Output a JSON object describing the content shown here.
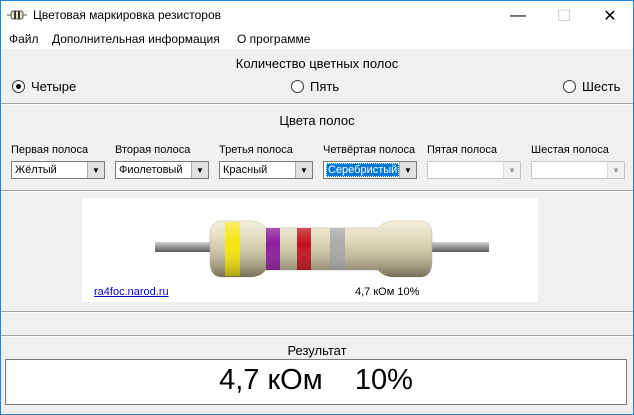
{
  "window": {
    "title": "Цветовая маркировка резисторов",
    "minimize_glyph": "—",
    "maximize_glyph": "☐",
    "close_glyph": "✕"
  },
  "menu": {
    "items": [
      "Файл",
      "Дополнительная информация",
      "О программе"
    ]
  },
  "band_count": {
    "title": "Количество цветных полос",
    "options": [
      "Четыре",
      "Пять",
      "Шесть"
    ],
    "selected": "Четыре"
  },
  "band_colors": {
    "title": "Цвета полос",
    "bands": [
      {
        "label": "Первая полоса",
        "value": "Жёлтый",
        "enabled": true,
        "focused": false
      },
      {
        "label": "Вторая полоса",
        "value": "Фиолетовый",
        "enabled": true,
        "focused": false
      },
      {
        "label": "Третья полоса",
        "value": "Красный",
        "enabled": true,
        "focused": false
      },
      {
        "label": "Четвёртая полоса",
        "value": "Серебристый",
        "enabled": true,
        "focused": true
      },
      {
        "label": "Пятая полоса",
        "value": "",
        "enabled": false,
        "focused": false
      },
      {
        "label": "Шестая полоса",
        "value": "",
        "enabled": false,
        "focused": false
      }
    ]
  },
  "resistor": {
    "band_colors": [
      "#f5e50f",
      "#8a1e9b",
      "#c3141d",
      "#a9a9a9"
    ],
    "body_color": "#dcd6b6",
    "lead_color": "#8c8c8c",
    "link_text": "ra4foc.narod.ru",
    "value_text": "4,7 кОм   10%"
  },
  "result": {
    "title": "Результат",
    "value": "4,7 кОм    10%"
  }
}
